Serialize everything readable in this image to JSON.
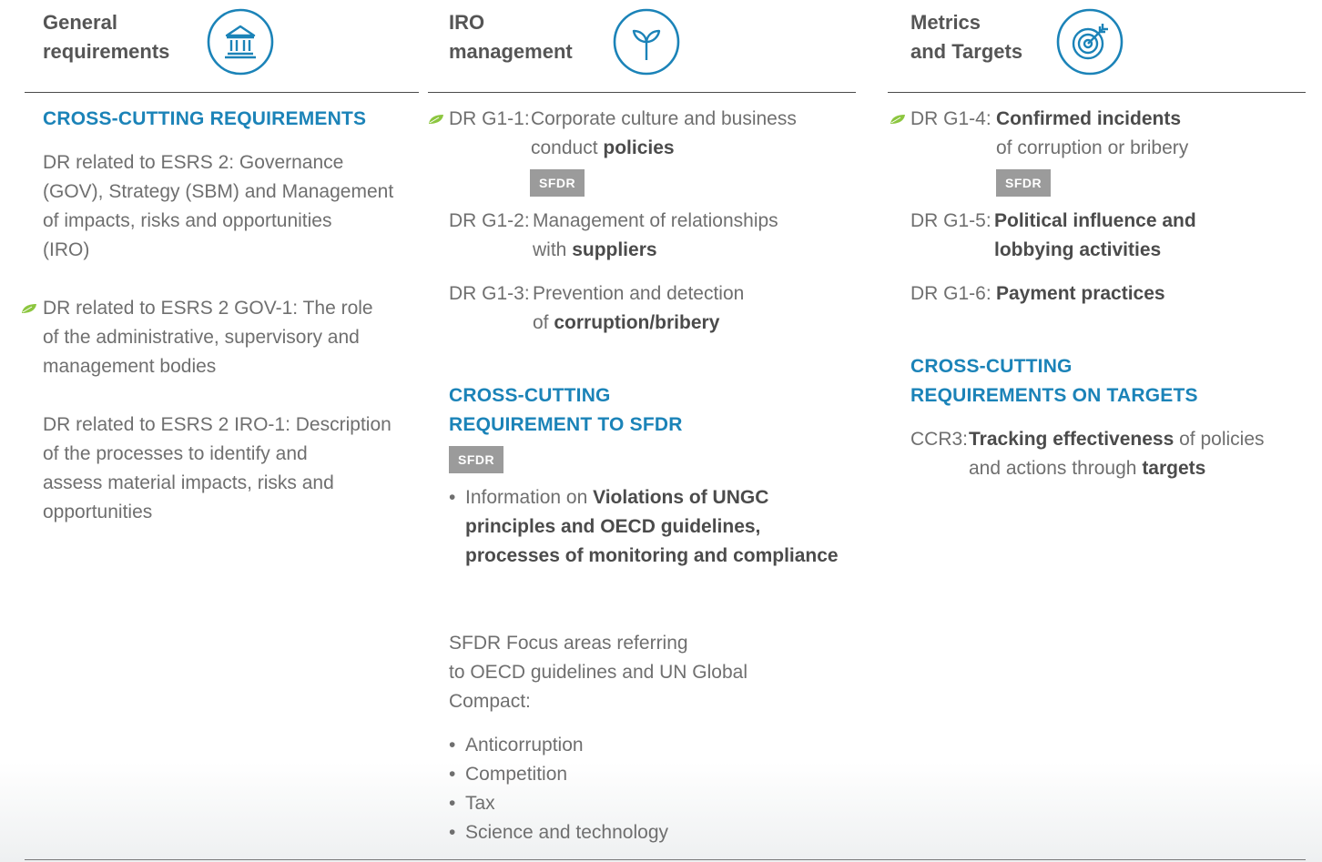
{
  "colors": {
    "accent": "#1b83b8",
    "leaf": "#8cc63f",
    "badge": "#9b9b9b"
  },
  "columns": [
    {
      "title_line1": "General",
      "title_line2": "requirements",
      "icon": "bank-icon"
    },
    {
      "title_line1": "IRO",
      "title_line2": "management",
      "icon": "sprout-icon"
    },
    {
      "title_line1": "Metrics",
      "title_line2": "and Targets",
      "icon": "target-icon"
    }
  ],
  "general": {
    "section_title": "CROSS-CUTTING REQUIREMENTS",
    "p1": [
      "DR related to ESRS 2: Governance",
      "(GOV), Strategy (SBM) and Management",
      "of impacts, risks and opportunities",
      "(IRO)"
    ],
    "p2": [
      "DR related to ESRS 2 GOV-1: The role",
      "of the administrative, supervisory and",
      "management bodies"
    ],
    "p3": [
      "DR related to ESRS 2 IRO-1: Description",
      "of the processes to identify and",
      "assess material impacts, risks and",
      "opportunities"
    ]
  },
  "iro": {
    "g11_label": "DR G1-1:",
    "g11_line1": "Corporate culture and business",
    "g11_line2_pre": "conduct ",
    "g11_line2_bold": "policies",
    "g11_badge": "SFDR",
    "g12_label": "DR G1-2:",
    "g12_line1": "Management of relationships",
    "g12_line2_pre": "with ",
    "g12_line2_bold": "suppliers",
    "g13_label": "DR G1-3:",
    "g13_line1": "Prevention and detection",
    "g13_line2_pre": "of ",
    "g13_line2_bold": "corruption/bribery",
    "section_title_line1": "CROSS-CUTTING",
    "section_title_line2": "REQUIREMENT TO SFDR",
    "section_badge": "SFDR",
    "info_pre": "Information on ",
    "info_bold1": "Violations of UNGC",
    "info_bold2": "principles and OECD guidelines,",
    "info_bold3": "processes of monitoring and",
    "info_bold4": "compliance",
    "focus": [
      "SFDR Focus areas referring",
      "to OECD guidelines and UN Global",
      "Compact:"
    ],
    "focus_items": [
      "Anticorruption",
      "Competition",
      "Tax",
      "Science and technology"
    ]
  },
  "metrics": {
    "g14_label": "DR G1-4:",
    "g14_line1_bold": "Confirmed incidents",
    "g14_line2": "of corruption or bribery",
    "g14_badge": "SFDR",
    "g15_label": "DR G1-5:",
    "g15_line1_bold": "Political influence and",
    "g15_line2_bold": "lobbying activities",
    "g16_label": "DR G1-6:",
    "g16_line1_bold": "Payment practices",
    "section_title_line1": "CROSS-CUTTING",
    "section_title_line2": "REQUIREMENTS ON TARGETS",
    "ccr3_label": "CCR3:",
    "ccr3_bold1": "Tracking effectiveness",
    "ccr3_post1": " of policies",
    "ccr3_pre2": "and actions through ",
    "ccr3_bold2": "targets"
  }
}
